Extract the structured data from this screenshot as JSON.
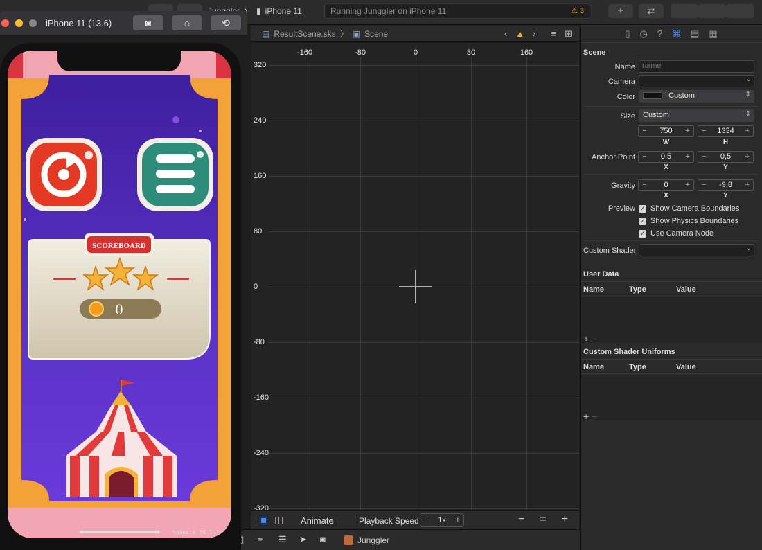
{
  "toolbar": {
    "scheme_name": "Junggler",
    "device": "iPhone 11",
    "activity_text": "Running Junggler on iPhone 11",
    "warning_count": "3"
  },
  "simulator": {
    "title": "iPhone 11 (13.6)",
    "buttons": [
      "screenshot-icon",
      "home-icon",
      "rotate-icon"
    ],
    "game": {
      "scoreboard_label": "SCOREBOARD",
      "stars": 3,
      "coins": "0",
      "stats": "nodes:6  58.1 fps"
    }
  },
  "jump_bar": {
    "file": "ResultScene.sks",
    "node": "Scene"
  },
  "canvas": {
    "x_ticks": [
      "-160",
      "-80",
      "0",
      "80",
      "160"
    ],
    "y_ticks": [
      "320",
      "240",
      "160",
      "80",
      "0",
      "-80",
      "-160",
      "-240",
      "-320"
    ]
  },
  "editor_bottom": {
    "animate_label": "Animate",
    "playback_label": "Playback Speed",
    "speed_value": "1x"
  },
  "debug_bar": {
    "target": "Junggler"
  },
  "inspector": {
    "section_title": "Scene",
    "name_label": "Name",
    "name_placeholder": "name",
    "camera_label": "Camera",
    "color_label": "Color",
    "color_value": "Custom",
    "size_label": "Size",
    "size_value": "Custom",
    "width_value": "750",
    "height_value": "1334",
    "w_label": "W",
    "h_label": "H",
    "anchor_label": "Anchor Point",
    "anchor_x": "0,5",
    "anchor_y": "0,5",
    "gravity_label": "Gravity",
    "gravity_x": "0",
    "gravity_y": "-9,8",
    "x_label": "X",
    "y_label": "Y",
    "preview_label": "Preview",
    "preview_options": [
      "Show Camera Boundaries",
      "Show Physics Boundaries",
      "Use Camera Node"
    ],
    "custom_shader_label": "Custom Shader",
    "user_data_title": "User Data",
    "uniforms_title": "Custom Shader Uniforms",
    "columns": [
      "Name",
      "Type",
      "Value"
    ]
  },
  "colors": {
    "accent": "#3f8ef7",
    "warning": "#e8b33a",
    "canvas_bg": "#232323"
  }
}
